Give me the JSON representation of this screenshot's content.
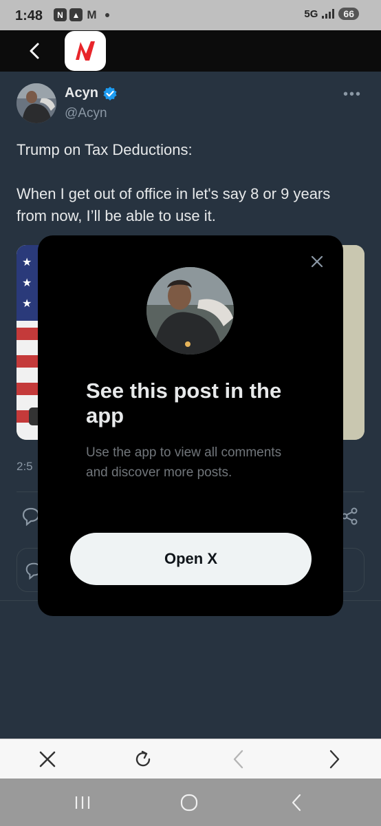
{
  "status_bar": {
    "time": "1:48",
    "network": "5G",
    "battery": "66",
    "notification_icons": [
      "app-n-icon",
      "apex-icon",
      "gmail-icon"
    ]
  },
  "header": {
    "back_icon": "chevron-left-icon",
    "app_logo": "news-app-logo"
  },
  "tweet": {
    "author_name": "Acyn",
    "verified": true,
    "handle": "@Acyn",
    "more_icon": "more-horizontal-icon",
    "text": "Trump on Tax Deductions:\n\nWhen I get out of office in let's say 8 or 9 years from now, I’ll be able to use it.",
    "time_partial": "2:5"
  },
  "modal": {
    "title": "See this post in the app",
    "subtitle": "Use the app to view all comments and discover more posts.",
    "button_label": "Open X",
    "close_icon": "close-icon"
  },
  "browser_bar": {
    "items": [
      "close-icon",
      "refresh-icon",
      "back-arrow-icon",
      "forward-arrow-icon"
    ]
  },
  "nav_bar": {
    "items": [
      "recents-icon",
      "home-icon",
      "back-icon"
    ]
  },
  "colors": {
    "background": "#273340",
    "modal": "#000000",
    "button": "#eff3f4",
    "verified": "#1d9bf0",
    "muted_text": "#8b98a5"
  }
}
